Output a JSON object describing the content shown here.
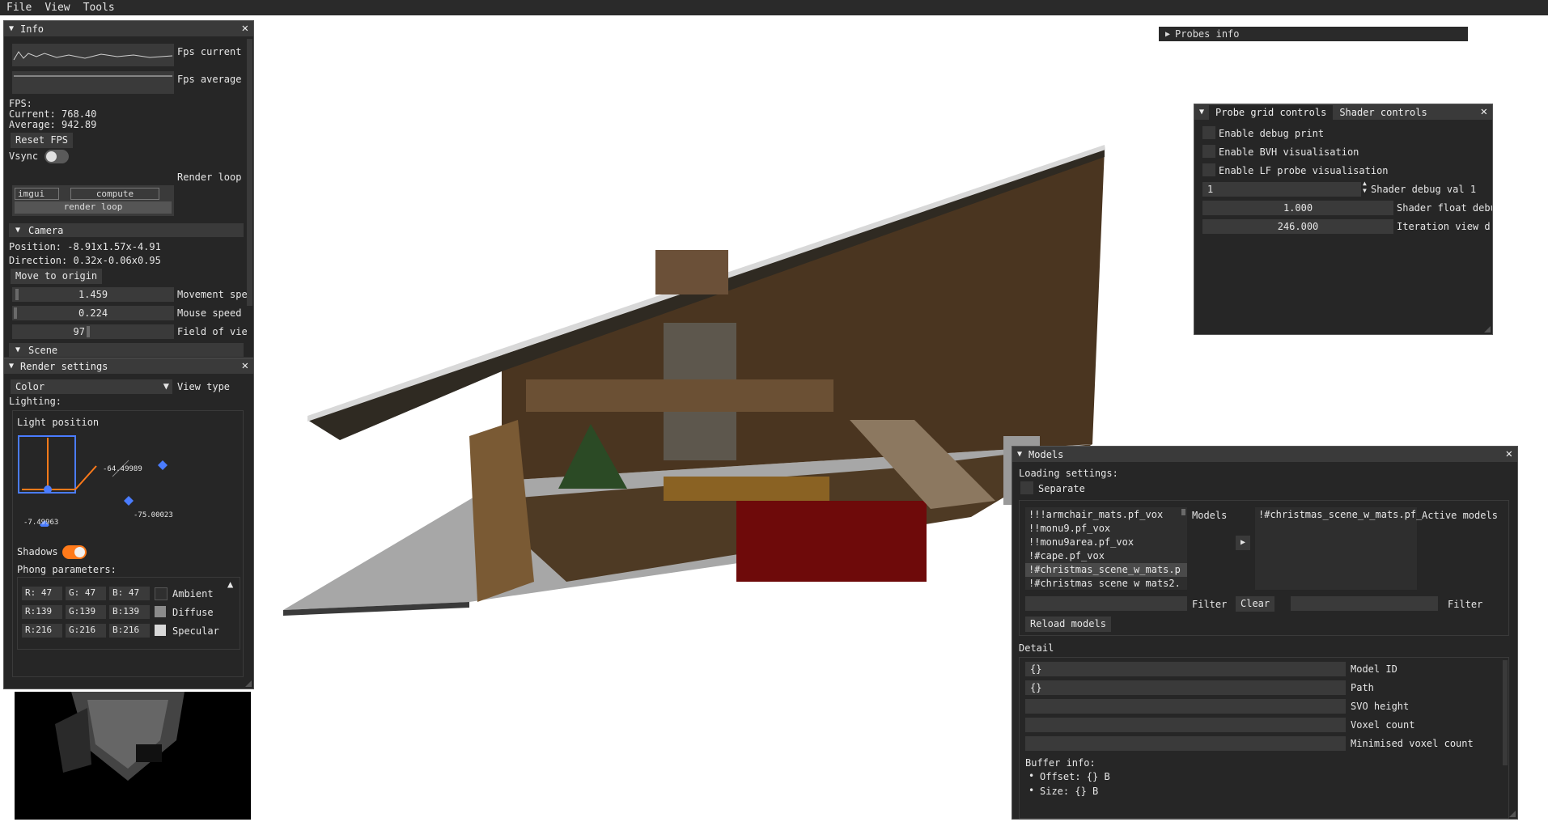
{
  "menu": [
    "File",
    "View",
    "Tools"
  ],
  "info": {
    "title": "Info",
    "fps_current_label": "Fps current",
    "fps_average_label": "Fps average",
    "fps_header": "FPS:",
    "current": "Current: 768.40",
    "average": "Average: 942.89",
    "reset_fps": "Reset FPS",
    "vsync": "Vsync",
    "render_loop_label": "Render loop",
    "segments": [
      "imgui",
      "compute"
    ],
    "render_loop_bar": "render loop",
    "camera_header": "Camera",
    "position": "Position: -8.91x1.57x-4.91",
    "direction": "Direction: 0.32x-0.06x0.95",
    "move_to_origin": "Move to origin",
    "movement_speed": {
      "value": "1.459",
      "label": "Movement spe"
    },
    "mouse_speed": {
      "value": "0.224",
      "label": "Mouse speed"
    },
    "fov": {
      "value": "97",
      "label": "Field of vie"
    },
    "scene_header": "Scene"
  },
  "render_settings": {
    "title": "Render settings",
    "view_type_value": "Color",
    "view_type_label": "View type",
    "lighting": "Lighting:",
    "light_position": "Light position",
    "gizmo_values": [
      "-64.49989",
      "-7.49963",
      "-75.00023"
    ],
    "shadows": "Shadows",
    "phong": "Phong parameters:",
    "rows": [
      {
        "r": "R: 47",
        "g": "G: 47",
        "b": "B: 47",
        "color": "#2f2f2f",
        "label": "Ambient"
      },
      {
        "r": "R:139",
        "g": "G:139",
        "b": "B:139",
        "color": "#8b8b8b",
        "label": "Diffuse"
      },
      {
        "r": "R:216",
        "g": "G:216",
        "b": "B:216",
        "color": "#d8d8d8",
        "label": "Specular"
      }
    ]
  },
  "probes_info": {
    "title": "Probes info"
  },
  "probe_panel": {
    "tabs": [
      "Probe grid controls",
      "Shader controls"
    ],
    "checks": [
      "Enable debug print",
      "Enable BVH visualisation",
      "Enable LF probe visualisation"
    ],
    "debug_val": {
      "value": "1",
      "label": "Shader debug val 1"
    },
    "float_debug": {
      "value": "1.000",
      "label": "Shader float debu"
    },
    "iteration": {
      "value": "246.000",
      "label": "Iteration view d"
    }
  },
  "models": {
    "title": "Models",
    "loading": "Loading settings:",
    "separate": "Separate",
    "list": [
      "!!!armchair_mats.pf_vox",
      "!!monu9.pf_vox",
      "!!monu9area.pf_vox",
      "!#cape.pf_vox",
      "!#christmas_scene_w_mats.p",
      "!#christmas scene w mats2."
    ],
    "models_label": "Models",
    "active": [
      "!#christmas_scene_w_mats.pf_"
    ],
    "active_label": "Active models",
    "filter": "Filter",
    "clear": "Clear",
    "reload": "Reload models",
    "detail": "Detail",
    "detail_fields": [
      {
        "value": "{}",
        "label": "Model ID"
      },
      {
        "value": "{}",
        "label": "Path"
      },
      {
        "value": "",
        "label": "SVO height"
      },
      {
        "value": "",
        "label": "Voxel count"
      },
      {
        "value": "",
        "label": "Minimised voxel count"
      }
    ],
    "buffer_info": "Buffer info:",
    "offset": "Offset: {} B",
    "size": "Size: {} B"
  },
  "colors": {
    "accent": "#4a7cff",
    "toggle_on": "#ff7a1a",
    "panel": "#262626",
    "field": "#3a3a3a"
  }
}
